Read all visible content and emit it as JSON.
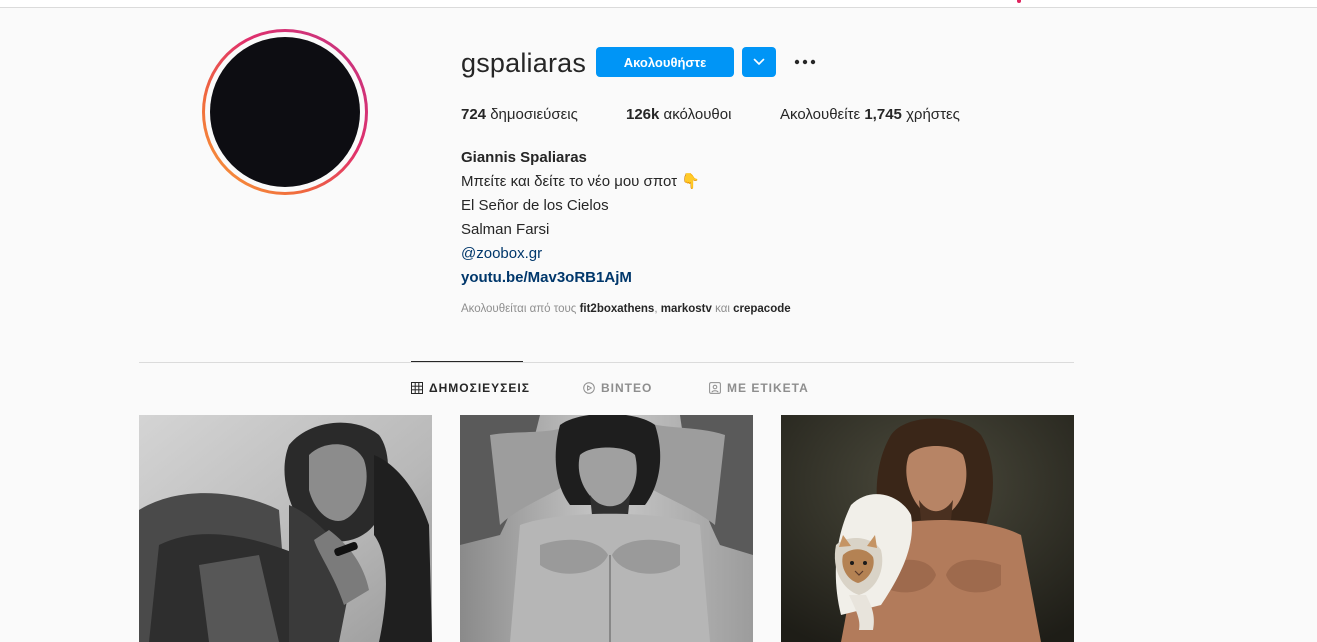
{
  "profile": {
    "username": "gspaliaras",
    "follow_label": "Ακολουθήστε",
    "stats": {
      "posts_count": "724",
      "posts_label": "δημοσιεύσεις",
      "followers_count": "126k",
      "followers_label": "ακόλουθοι",
      "following_prefix": "Ακολουθείτε",
      "following_count": "1,745",
      "following_suffix": "χρήστες"
    },
    "bio": {
      "full_name": "Giannis Spaliaras",
      "line1": "Μπείτε και δείτε το νέο μου σποτ 👇",
      "line2": "El Señor de los Cielos",
      "line3": "Salman Farsi",
      "mention": "@zoobox.gr",
      "link": "youtu.be/Mav3oRB1AjM"
    },
    "followed_by": {
      "prefix": "Ακολουθείται από τους",
      "account1": "fit2boxathens",
      "sep": ",",
      "account2": "markostv",
      "and": "και",
      "account3": "crepacode"
    }
  },
  "tabs": [
    {
      "label": "ΔΗΜΟΣΙΕΥΣΕΙΣ",
      "icon": "grid-icon",
      "active": true
    },
    {
      "label": "ΒΙΝΤΕΟ",
      "icon": "video-icon",
      "active": false
    },
    {
      "label": "ΜΕ ΕΤΙΚΕΤΑ",
      "icon": "tagged-icon",
      "active": false
    }
  ],
  "colors": {
    "accent": "#0095f6",
    "link": "#00376b",
    "muted": "#8e8e8e"
  }
}
